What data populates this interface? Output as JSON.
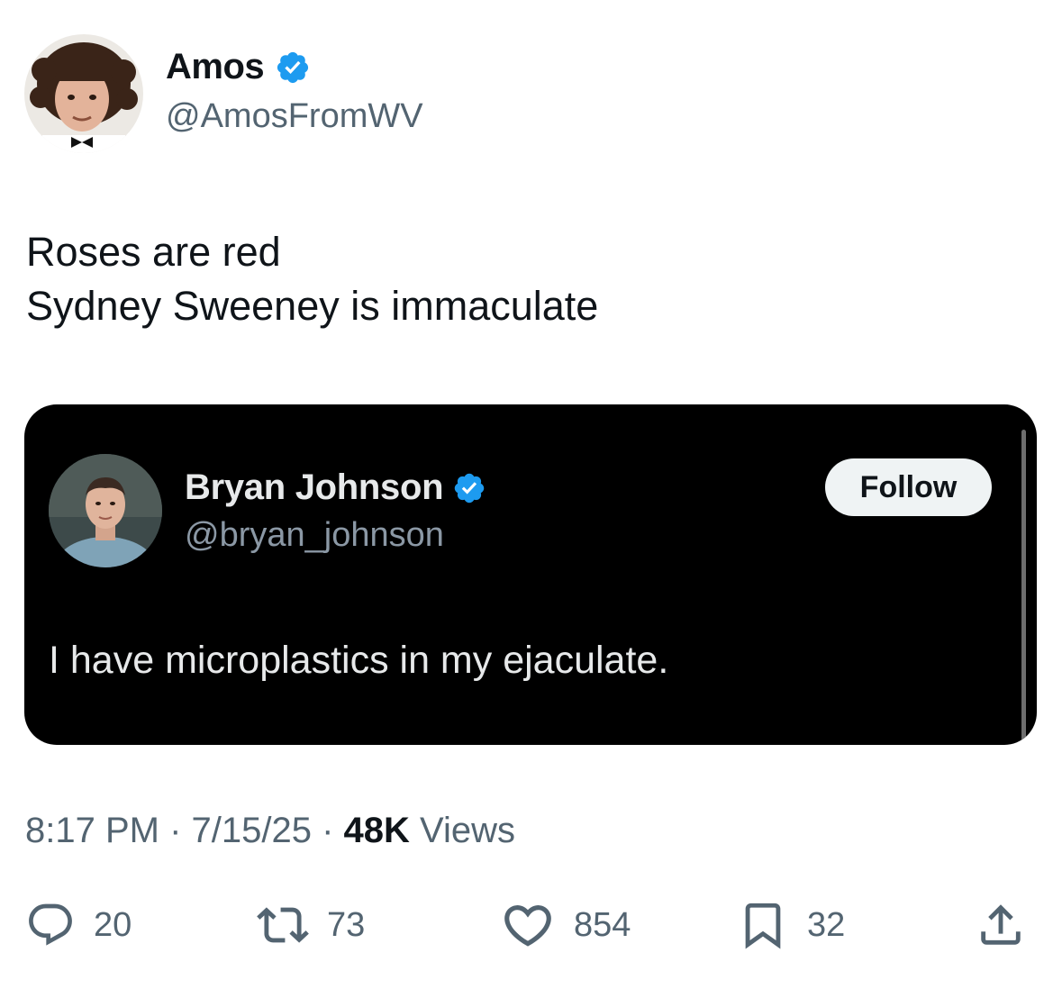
{
  "tweet": {
    "author": {
      "name": "Amos",
      "handle": "@AmosFromWV",
      "verified": true
    },
    "text_lines": [
      "Roses are red",
      "Sydney Sweeney is immaculate"
    ],
    "quoted": {
      "author": {
        "name": "Bryan Johnson",
        "handle": "@bryan_johnson",
        "verified": true
      },
      "follow_label": "Follow",
      "text": "I have microplastics in my ejaculate."
    },
    "meta": {
      "time": "8:17 PM",
      "separator": " · ",
      "date": "7/15/25",
      "views_count": "48K",
      "views_label": " Views"
    },
    "actions": {
      "replies": "20",
      "reposts": "73",
      "likes": "854",
      "bookmarks": "32"
    }
  },
  "colors": {
    "verified": "#1d9bf0",
    "secondary_text": "#536471",
    "quote_bg": "#000000"
  },
  "icons": {
    "reply": "speech-bubble-icon",
    "repost": "repost-arrows-icon",
    "like": "heart-icon",
    "bookmark": "bookmark-icon",
    "share": "share-upload-icon"
  }
}
